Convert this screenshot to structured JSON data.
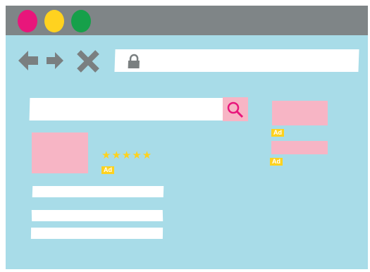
{
  "window": {
    "controls": [
      "close",
      "minimize",
      "maximize"
    ],
    "colors": {
      "close": "#e8167b",
      "minimize": "#ffd21f",
      "maximize": "#16a04a",
      "titlebar": "#7f8587",
      "page": "#a8dce8",
      "ad_block": "#f7b5c5",
      "badge": "#ffd21f"
    }
  },
  "toolbar": {
    "icons": [
      "back-arrow-icon",
      "forward-arrow-icon",
      "close-x-icon",
      "lock-icon"
    ],
    "address_value": ""
  },
  "search": {
    "value": "",
    "button_icon": "search-icon"
  },
  "main_result": {
    "rating_stars": 5,
    "stars_text": "★★★★★",
    "badge": "Ad"
  },
  "sidebar_ads": [
    {
      "badge": "Ad"
    },
    {
      "badge": "Ad"
    }
  ]
}
